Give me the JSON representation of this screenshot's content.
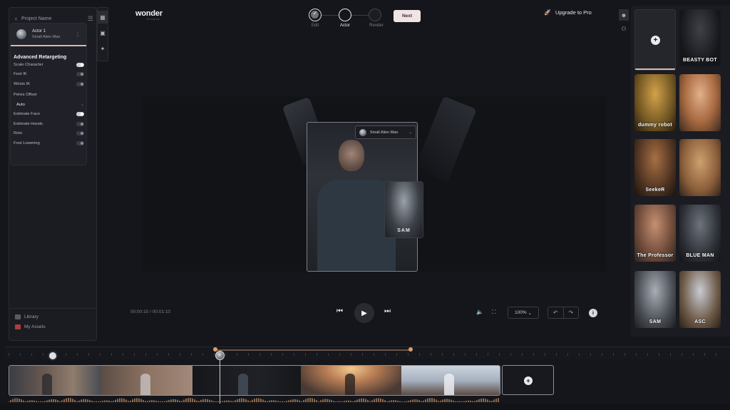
{
  "sidebar": {
    "project_name": "Project Name",
    "actor": {
      "name": "Actor 1",
      "character": "Small Alien Man"
    },
    "section_title": "Advanced Retargeting",
    "options": [
      {
        "label": "Scale Character",
        "on": true
      },
      {
        "label": "Feet IK",
        "on": false
      },
      {
        "label": "Wrists IK",
        "on": false
      }
    ],
    "pelvis_offset": {
      "label": "Pelvis Offset",
      "value": "Auto"
    },
    "options2": [
      {
        "label": "Estimate Face",
        "on": true
      },
      {
        "label": "Estimate Hands",
        "on": false
      },
      {
        "label": "Roto",
        "on": false
      },
      {
        "label": "Foot Lowering",
        "on": false
      }
    ],
    "library_label": "Library",
    "assets_label": "My Assets"
  },
  "header": {
    "logo": "wonder",
    "logo_sub": "STUDIO",
    "steps": [
      "Edit",
      "Actor",
      "Render"
    ],
    "next_label": "Next",
    "upgrade_label": "Upgrade to Pro"
  },
  "viewer": {
    "actor_dropdown": "Small Alien Man",
    "overlay_card_text": "SAM"
  },
  "player": {
    "current_time": "00:00:10",
    "total_time": "00:01:10",
    "time_separator": "/",
    "zoom": "100%"
  },
  "characters": [
    {
      "name": "BEASTY BOT"
    },
    {
      "name": "dummy robot"
    },
    {
      "name": ""
    },
    {
      "name": "SeekeR"
    },
    {
      "name": ""
    },
    {
      "name": "The Professor"
    },
    {
      "name": "BLUE MAN"
    },
    {
      "name": "SAM"
    },
    {
      "name": "ASC"
    }
  ],
  "colors": {
    "accent": "#f1e4e6",
    "timeline_range": "#d9a06f",
    "background": "#15161b"
  },
  "icons": {
    "back": "chevron-left-icon",
    "play": "play-icon",
    "prev": "skip-back-icon",
    "next": "skip-forward-icon",
    "info": "info-icon",
    "upgrade": "rocket-icon"
  }
}
